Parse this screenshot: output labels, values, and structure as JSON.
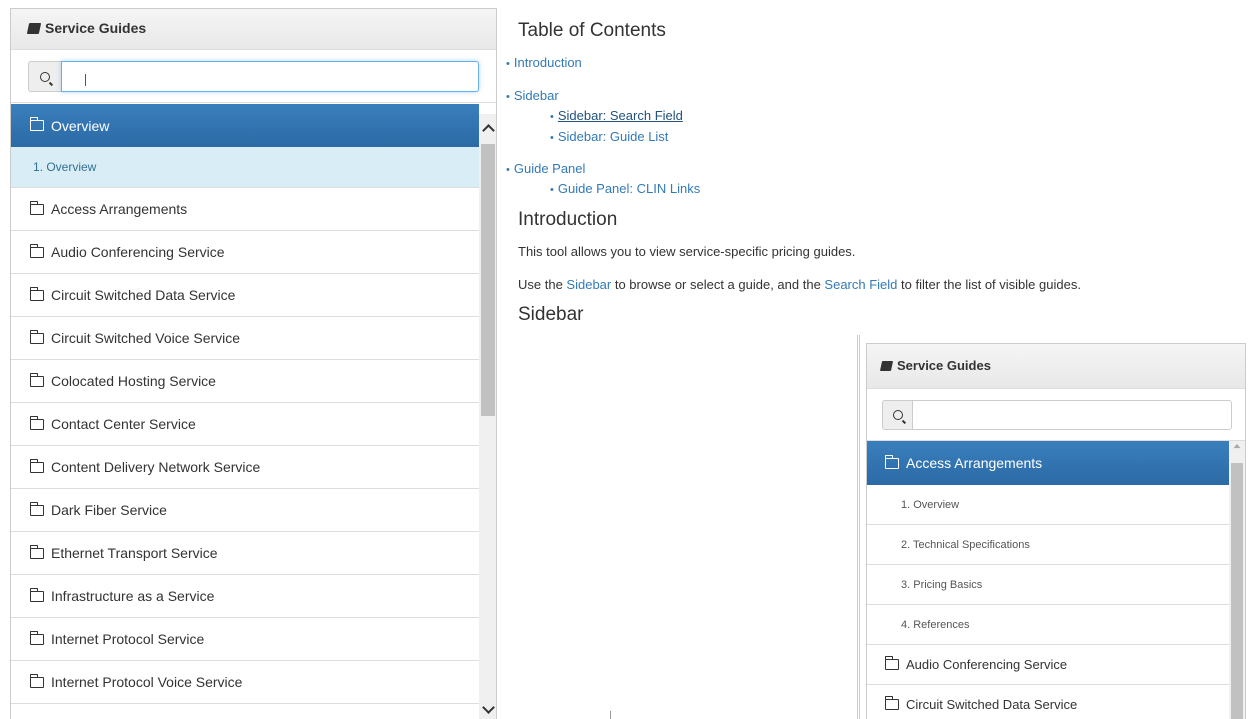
{
  "sidebar": {
    "title": "Service Guides",
    "search": {
      "value": "",
      "placeholder": ""
    },
    "items": [
      {
        "label": "Overview",
        "active": true
      },
      {
        "label": "1. Overview",
        "sub": true
      },
      {
        "label": "Access Arrangements"
      },
      {
        "label": "Audio Conferencing Service"
      },
      {
        "label": "Circuit Switched Data Service"
      },
      {
        "label": "Circuit Switched Voice Service"
      },
      {
        "label": "Colocated Hosting Service"
      },
      {
        "label": "Contact Center Service"
      },
      {
        "label": "Content Delivery Network Service"
      },
      {
        "label": "Dark Fiber Service"
      },
      {
        "label": "Ethernet Transport Service"
      },
      {
        "label": "Infrastructure as a Service"
      },
      {
        "label": "Internet Protocol Service"
      },
      {
        "label": "Internet Protocol Voice Service"
      }
    ]
  },
  "main": {
    "toc_title": "Table of Contents",
    "toc": {
      "introduction": "Introduction",
      "sidebar": "Sidebar",
      "sidebar_search": "Sidebar: Search Field",
      "sidebar_list": "Sidebar: Guide List",
      "guide_panel": "Guide Panel",
      "guide_panel_clin": "Guide Panel: CLIN Links"
    },
    "intro_title": "Introduction",
    "intro_p1": "This tool allows you to view service-specific pricing guides.",
    "intro_p2": {
      "t1": "Use the ",
      "link1": "Sidebar",
      "t2": " to browse or select a guide, and the ",
      "link2": "Search Field",
      "t3": " to filter the list of visible guides."
    },
    "sidebar_title": "Sidebar"
  },
  "inset": {
    "title": "Service Guides",
    "active": "Access Arrangements",
    "sub_items": [
      "1. Overview",
      "2. Technical Specifications",
      "3. Pricing Basics",
      "4. References"
    ],
    "items": [
      "Audio Conferencing Service",
      "Circuit Switched Data Service"
    ]
  }
}
